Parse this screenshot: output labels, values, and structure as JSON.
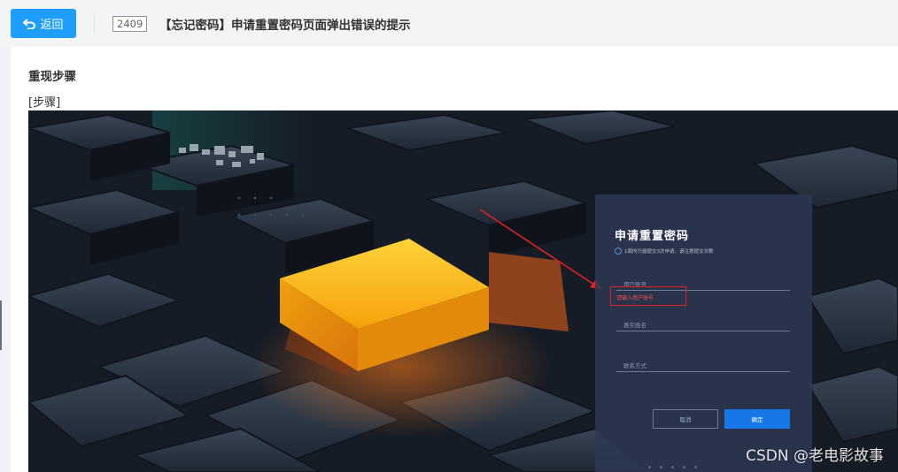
{
  "header": {
    "back_label": "返回",
    "issue_id": "2409",
    "issue_title": "【忘记密码】申请重置密码页面弹出错误的提示"
  },
  "content": {
    "section_heading": "重现步骤",
    "step_label": "[步骤]"
  },
  "screenshot": {
    "dialog_title": "申请重置密码",
    "dialog_hint": "1周内只能提交3次申请，请注意提交次数",
    "username_placeholder": "用户账号",
    "username_error": "请输入用户账号",
    "realname_placeholder": "真实姓名",
    "phone_placeholder": "联系方式",
    "cancel_label": "取消",
    "ok_label": "确定",
    "watermark": "CSDN @老电影故事"
  },
  "colors": {
    "primary": "#1e9fff",
    "error": "#ff4d4f",
    "highlight": "#f5b416"
  },
  "icons": {
    "back": "back-arrow-icon"
  }
}
